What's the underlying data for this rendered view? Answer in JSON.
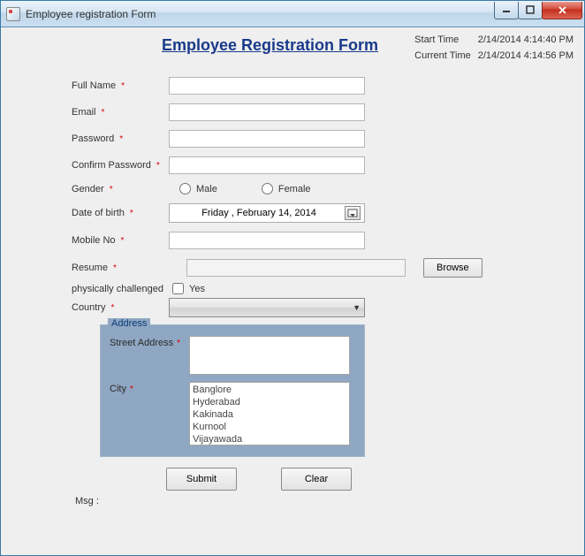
{
  "window": {
    "title": "Employee registration Form"
  },
  "header": {
    "form_title": "Employee Registration Form",
    "start_time_label": "Start Time",
    "start_time_value": "2/14/2014 4:14:40 PM",
    "current_time_label": "Current Time",
    "current_time_value": "2/14/2014 4:14:56 PM"
  },
  "labels": {
    "full_name": "Full Name",
    "email": "Email",
    "password": "Password",
    "confirm_password": "Confirm Password",
    "gender": "Gender",
    "dob": "Date of birth",
    "mobile": "Mobile No",
    "resume": "Resume",
    "phys": "physically challenged",
    "country": "Country",
    "address_group": "Address",
    "street": "Street Address",
    "city": "City",
    "msg": "Msg :"
  },
  "required_marker": "*",
  "gender": {
    "male": "Male",
    "female": "Female"
  },
  "dob_value": "Friday    ,  February   14, 2014",
  "phys_option": "Yes",
  "buttons": {
    "browse": "Browse",
    "submit": "Submit",
    "clear": "Clear"
  },
  "cities": [
    "Banglore",
    "Hyderabad",
    "Kakinada",
    "Kurnool",
    "Vijayawada"
  ],
  "values": {
    "full_name": "",
    "email": "",
    "password": "",
    "confirm_password": "",
    "mobile": "",
    "resume": "",
    "country": "",
    "street": ""
  }
}
